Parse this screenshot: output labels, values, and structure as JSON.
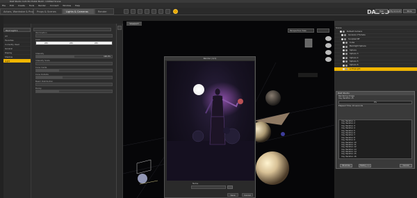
{
  "window": {
    "title": "DAZ Studio 4.21 Pro Public Build - Untitled Scene"
  },
  "menu": [
    "File",
    "Edit",
    "Create",
    "Tools",
    "Render",
    "Connect",
    "Window",
    "Help"
  ],
  "top_tabs": [
    {
      "label": "Actors, Wardrobe & Props",
      "active": false
    },
    {
      "label": "Props & Scenes",
      "active": false
    },
    {
      "label": "Lights & Cameras",
      "active": true
    },
    {
      "label": "Render",
      "active": false
    }
  ],
  "brand": {
    "logo": "DAZ 3D"
  },
  "top_buttons": [
    "Help",
    "My Account",
    "Store"
  ],
  "left": {
    "tabs": [
      "Library",
      "Editor"
    ],
    "node_selector": "Point Light 1",
    "items": [
      {
        "label": "All",
        "selected": false
      },
      {
        "label": "Favorites",
        "selected": false
      },
      {
        "label": "Currently Used",
        "selected": false
      },
      {
        "label": "General",
        "selected": false
      },
      {
        "label": "Display",
        "selected": false
      },
      {
        "label": "Shadow",
        "selected": false
      },
      {
        "label": "Light",
        "selected": true
      }
    ]
  },
  "properties": [
    {
      "label": "Illumination",
      "value": "",
      "fill": 0
    },
    {
      "label": "Color",
      "value": "",
      "fill": 0,
      "color_values": [
        "255",
        "255",
        "255"
      ]
    },
    {
      "label": "Intensity",
      "value": "100.0%",
      "fill": 0.5
    },
    {
      "label": "Intensity Scale",
      "value": "",
      "fill": 0
    },
    {
      "label": "Cone Inside",
      "value": "",
      "fill": 0.3
    },
    {
      "label": "Cone Outside",
      "value": "",
      "fill": 0.35
    },
    {
      "label": "Beam Distribution",
      "value": "",
      "fill": 0
    },
    {
      "label": "Decay",
      "value": "",
      "fill": 0.3
    }
  ],
  "viewport": {
    "tab": "Viewport",
    "camera": "Perspective View"
  },
  "render_window": {
    "title": "Render (1/1)",
    "name_label": "Name",
    "save_label": "Save",
    "cancel_label": "Cancel"
  },
  "scene": {
    "header": "Scene",
    "items": [
      {
        "label": "Default Camera",
        "selected": false
      },
      {
        "label": "Genesis 2 Female",
        "selected": false
      },
      {
        "label": "Sculpted BF",
        "selected": false
      },
      {
        "label": "Cube",
        "selected": false
      },
      {
        "label": "Backlight Sphere",
        "selected": false
      },
      {
        "label": "Sphere",
        "selected": false
      },
      {
        "label": "Sphere 3",
        "selected": false
      },
      {
        "label": "Sphere 4",
        "selected": false
      },
      {
        "label": "Sphere 5",
        "selected": false
      },
      {
        "label": "Sphere 6",
        "selected": false
      },
      {
        "label": "sciTopLight",
        "selected": true
      }
    ]
  },
  "progress": {
    "title": "DAZ Studio",
    "subtitle": "Rendering Image",
    "iter_label": "Iray Iteration 15",
    "progress_percent": "0%",
    "progress_fill": 0.0,
    "elapsed": "Elapsed Time: 22 seconds",
    "log": [
      "Iray Iteration 1",
      "Iray Iteration 2",
      "Iray Iteration 3",
      "Iray Iteration 4",
      "Iray Iteration 5",
      "Iray Iteration 6",
      "Iray Iteration 7",
      "Iray Iteration 8",
      "Iray Iteration 9",
      "Iray Iteration 10",
      "Iray Iteration 11",
      "Iray Iteration 12",
      "Iray Iteration 13",
      "Iray Iteration 14",
      "Iray Iteration 15",
      "Iray Iteration 16"
    ],
    "minimize_label": "Minimize",
    "history_label": "History >>",
    "cancel_label": "Cancel"
  }
}
